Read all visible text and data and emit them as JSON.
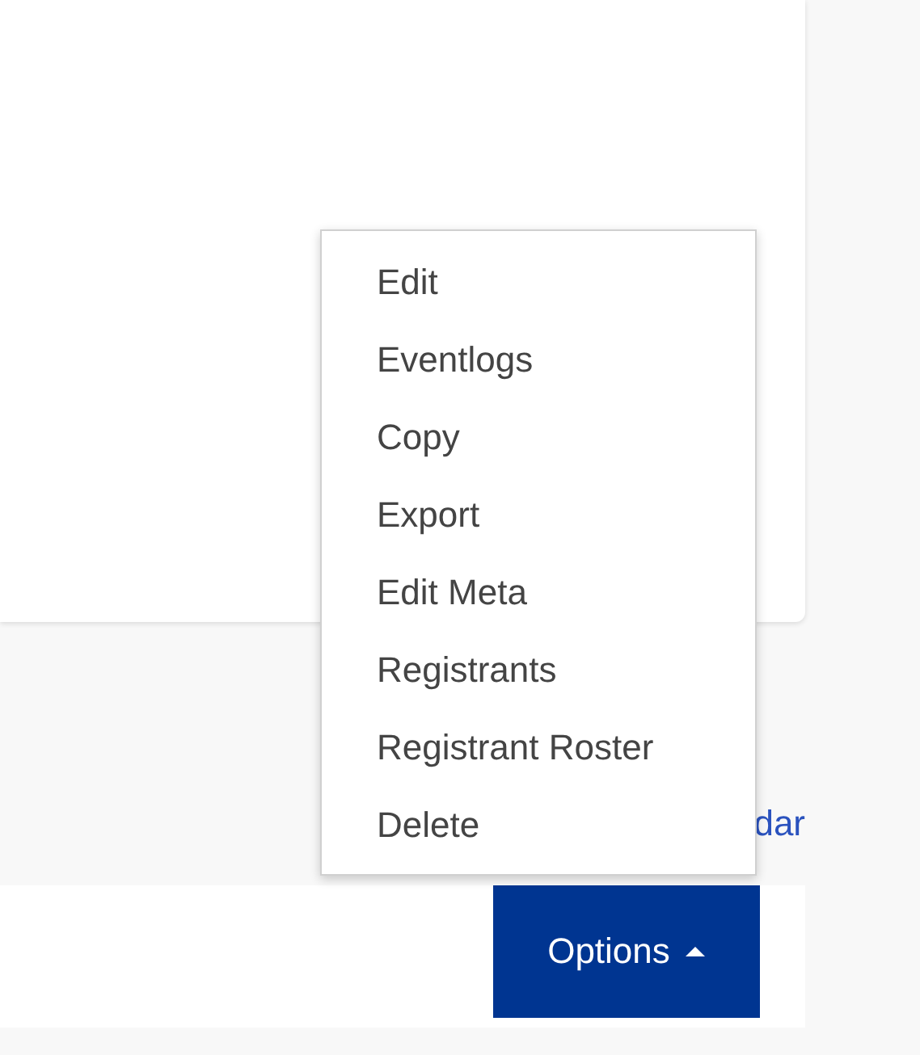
{
  "link": {
    "text": "dar"
  },
  "options_button": {
    "label": "Options",
    "expanded": true
  },
  "menu": {
    "items": [
      {
        "label": "Edit"
      },
      {
        "label": "Eventlogs"
      },
      {
        "label": "Copy"
      },
      {
        "label": "Export"
      },
      {
        "label": "Edit Meta"
      },
      {
        "label": "Registrants"
      },
      {
        "label": "Registrant Roster"
      },
      {
        "label": "Delete"
      }
    ]
  }
}
